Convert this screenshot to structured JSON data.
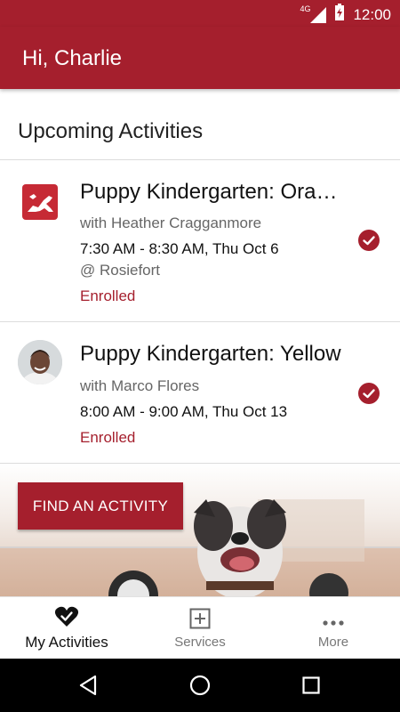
{
  "status_bar": {
    "network": "4G",
    "time": "12:00"
  },
  "header": {
    "greeting": "Hi, Charlie"
  },
  "section": {
    "title": "Upcoming Activities"
  },
  "activities": [
    {
      "name": "Puppy Kindergarten: Ora…",
      "instructor": "with Heather Cragganmore",
      "time": "7:30 AM - 8:30 AM, Thu Oct 6",
      "location": "@ Rosiefort",
      "status": "Enrolled",
      "thumb_icon": "dog-stretch-icon"
    },
    {
      "name": "Puppy Kindergarten: Yellow",
      "instructor": "with Marco Flores",
      "time": "8:00 AM - 9:00 AM, Thu Oct 13",
      "status": "Enrolled",
      "thumb_icon": "instructor-avatar"
    }
  ],
  "cta": {
    "label": "FIND AN ACTIVITY"
  },
  "bottom_nav": [
    {
      "label": "My Activities",
      "icon": "heart-check-icon",
      "active": true
    },
    {
      "label": "Services",
      "icon": "plus-box-icon",
      "active": false
    },
    {
      "label": "More",
      "icon": "more-dots-icon",
      "active": false
    }
  ],
  "colors": {
    "brand": "#a51f2d"
  }
}
